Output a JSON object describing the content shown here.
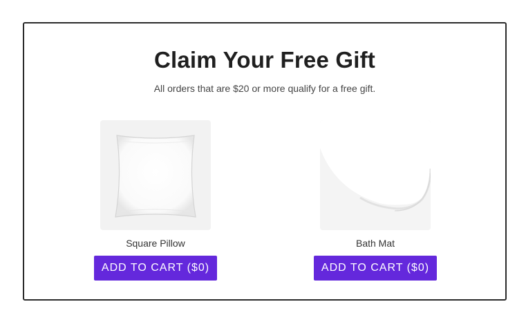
{
  "modal": {
    "title": "Claim Your Free Gift",
    "subtitle": "All orders that are $20 or more qualify for a free gift."
  },
  "products": [
    {
      "name": "Square Pillow",
      "button_label": "ADD TO CART ($0)",
      "image": "square-pillow-image"
    },
    {
      "name": "Bath Mat",
      "button_label": "ADD TO CART ($0)",
      "image": "bath-mat-image"
    }
  ],
  "colors": {
    "button_bg": "#6428dc",
    "button_text": "#ffffff",
    "border": "#2a2a2a",
    "thumb_bg": "#f2f2f2"
  }
}
